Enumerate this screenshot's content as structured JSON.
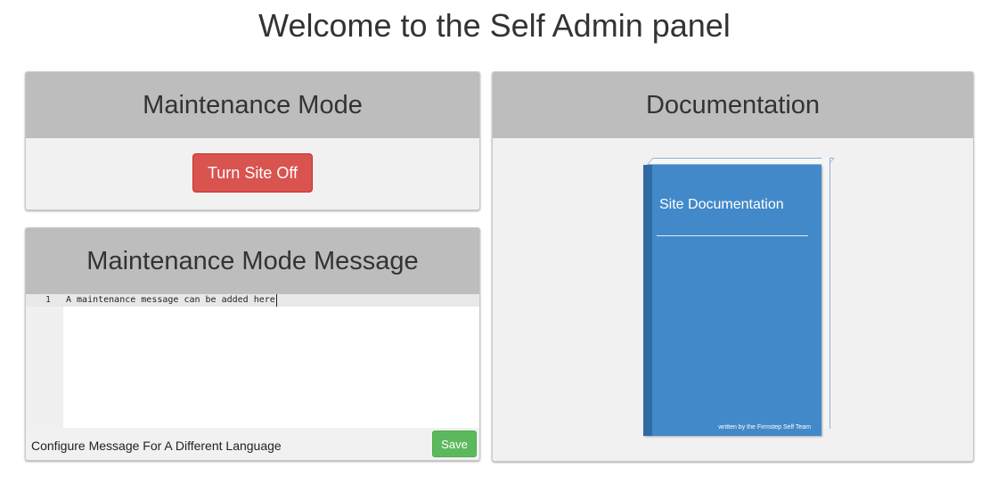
{
  "page": {
    "title": "Welcome to the Self Admin panel"
  },
  "maintenance": {
    "header": "Maintenance Mode",
    "toggle_button": "Turn Site Off",
    "button_color": "#d9534f"
  },
  "message": {
    "header": "Maintenance Mode Message",
    "editor": {
      "lines": [
        {
          "number": "1",
          "text": "A maintenance message can be added here"
        }
      ]
    },
    "configure_link": "Configure Message For A Different Language",
    "save_label": "Save",
    "save_color": "#5cb85c"
  },
  "documentation": {
    "header": "Documentation",
    "book": {
      "title": "Site Documentation",
      "footer": "written by the Firmstep Self Team",
      "icon": "book-icon",
      "cover_color": "#4289c9"
    }
  }
}
